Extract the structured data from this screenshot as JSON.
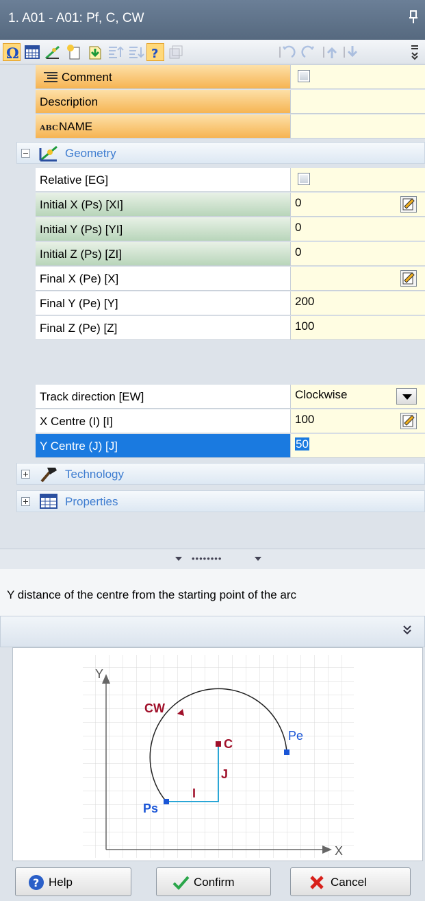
{
  "window": {
    "title": "1. A01 - A01: Pf, C, CW"
  },
  "properties": {
    "comment": {
      "label": "Comment"
    },
    "description": {
      "label": "Description",
      "value": ""
    },
    "name": {
      "label": "NAME",
      "value": ""
    },
    "geometry": {
      "label": "Geometry"
    },
    "relative": {
      "label": "Relative [EG]"
    },
    "initial_x": {
      "label": "Initial X (Ps) [XI]",
      "value": "0"
    },
    "initial_y": {
      "label": "Initial Y (Ps) [YI]",
      "value": "0"
    },
    "initial_z": {
      "label": "Initial Z (Ps) [ZI]",
      "value": "0"
    },
    "final_x": {
      "label": "Final X (Pe) [X]",
      "value": ""
    },
    "final_y": {
      "label": "Final Y (Pe) [Y]",
      "value": "200"
    },
    "final_z": {
      "label": "Final Z (Pe) [Z]",
      "value": "100"
    },
    "track_direction": {
      "label": "Track direction [EW]",
      "value": "Clockwise"
    },
    "x_centre": {
      "label": "X Centre (I) [I]",
      "value": "100"
    },
    "y_centre": {
      "label": "Y Centre (J) [J]",
      "value": "50"
    },
    "technology": {
      "label": "Technology"
    },
    "props": {
      "label": "Properties"
    }
  },
  "help": {
    "text": "Y distance of the centre from the starting point of the arc"
  },
  "diagram": {
    "y_axis": "Y",
    "x_axis": "X",
    "cw": "CW",
    "pe": "Pe",
    "ps": "Ps",
    "c": "C",
    "i": "I",
    "j": "J"
  },
  "buttons": {
    "help": "Help",
    "confirm": "Confirm",
    "cancel": "Cancel"
  },
  "colors": {
    "title_bar": "#5e718a",
    "selection": "#1a7ae0",
    "orange_row": "#f6b452",
    "green_row": "#b8d5ba",
    "value_bg": "#fffde2",
    "group_text": "#3f7dd0",
    "arc_label": "#a0102a",
    "point_label": "#1a55d6"
  }
}
